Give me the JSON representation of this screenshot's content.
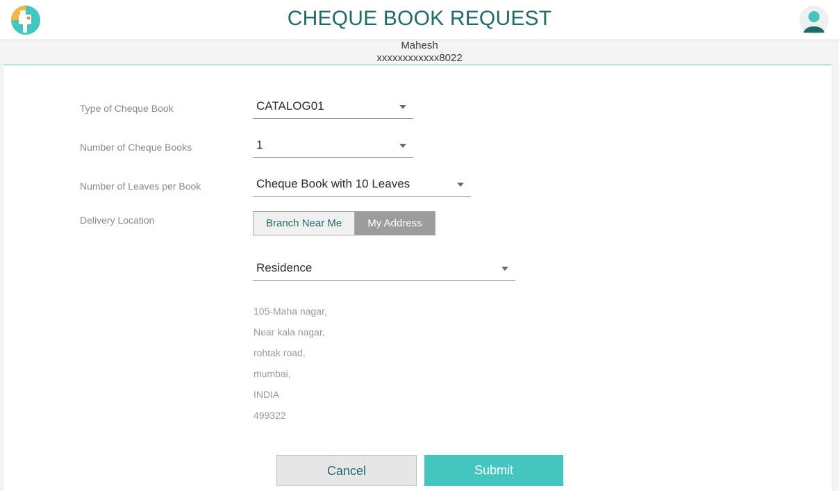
{
  "header": {
    "title": "CHEQUE BOOK REQUEST",
    "logo_icon": "mailbox-icon",
    "avatar_icon": "user-avatar-icon"
  },
  "account": {
    "name": "Mahesh",
    "number": "xxxxxxxxxxxx8022"
  },
  "form": {
    "cheque_type": {
      "label": "Type of Cheque Book",
      "value": "CATALOG01"
    },
    "book_count": {
      "label": "Number of Cheque Books",
      "value": "1"
    },
    "leaves": {
      "label": "Number of Leaves per Book",
      "value": "Cheque Book with 10 Leaves"
    },
    "delivery": {
      "label": "Delivery Location",
      "options": [
        "Branch Near Me",
        "My Address"
      ],
      "selected": "My Address"
    },
    "address_type": {
      "value": "Residence"
    },
    "address_lines": [
      "105-Maha nagar,",
      "Near kala nagar,",
      "rohtak road,",
      "mumbai,",
      "INDIA",
      "499322"
    ]
  },
  "actions": {
    "cancel_label": "Cancel",
    "submit_label": "Submit"
  },
  "colors": {
    "brand_teal": "#1f6b68",
    "accent": "#43c6be",
    "toggle_selected": "#9c9c9c"
  }
}
